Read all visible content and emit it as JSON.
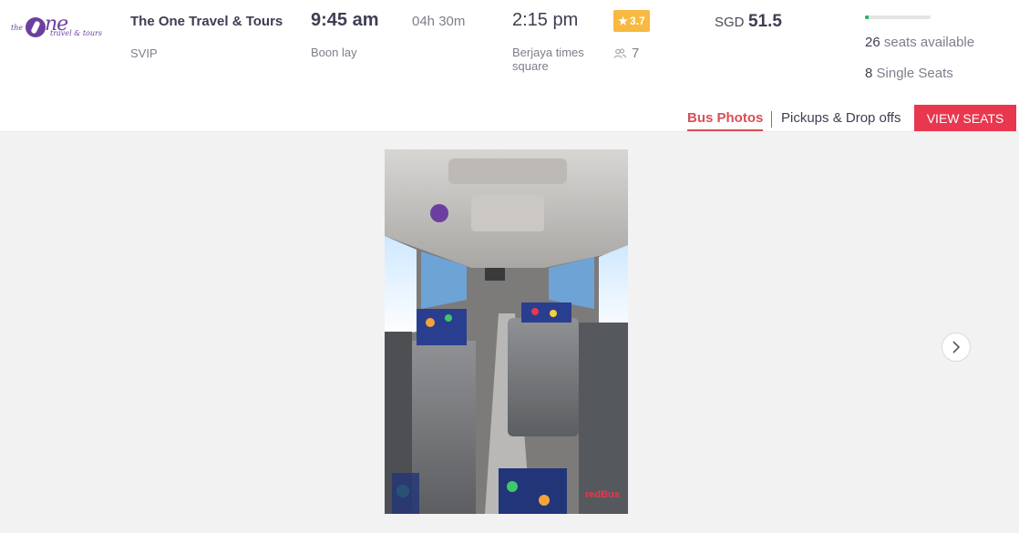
{
  "operator": {
    "logo_small": "the",
    "logo_big": "ne",
    "logo_sub": "travel & tours",
    "name": "The One Travel & Tours",
    "bus_type": "SVIP"
  },
  "departure": {
    "time": "9:45 am",
    "location": "Boon lay"
  },
  "duration": "04h 30m",
  "arrival": {
    "time": "2:15 pm",
    "location": "Berjaya times square"
  },
  "rating": {
    "value": "3.7",
    "star": "★",
    "color": "#f7b93f"
  },
  "reviews": {
    "count": "7",
    "icon": "people-icon"
  },
  "price": {
    "currency": "SGD",
    "amount": "51.5"
  },
  "seats": {
    "available_count": "26",
    "available_text": "seats available",
    "availability_fraction": 0.05,
    "single_count": "8",
    "single_text": "Single Seats"
  },
  "tabs": {
    "photos": "Bus Photos",
    "pickups": "Pickups & Drop offs"
  },
  "view_seats": "VIEW SEATS",
  "gallery": {
    "watermark": "redBus",
    "next_icon": "chevron-right-icon"
  },
  "colors": {
    "accent": "#d84e55",
    "button": "#e8374f",
    "seat_bar": "#2eb06c"
  }
}
